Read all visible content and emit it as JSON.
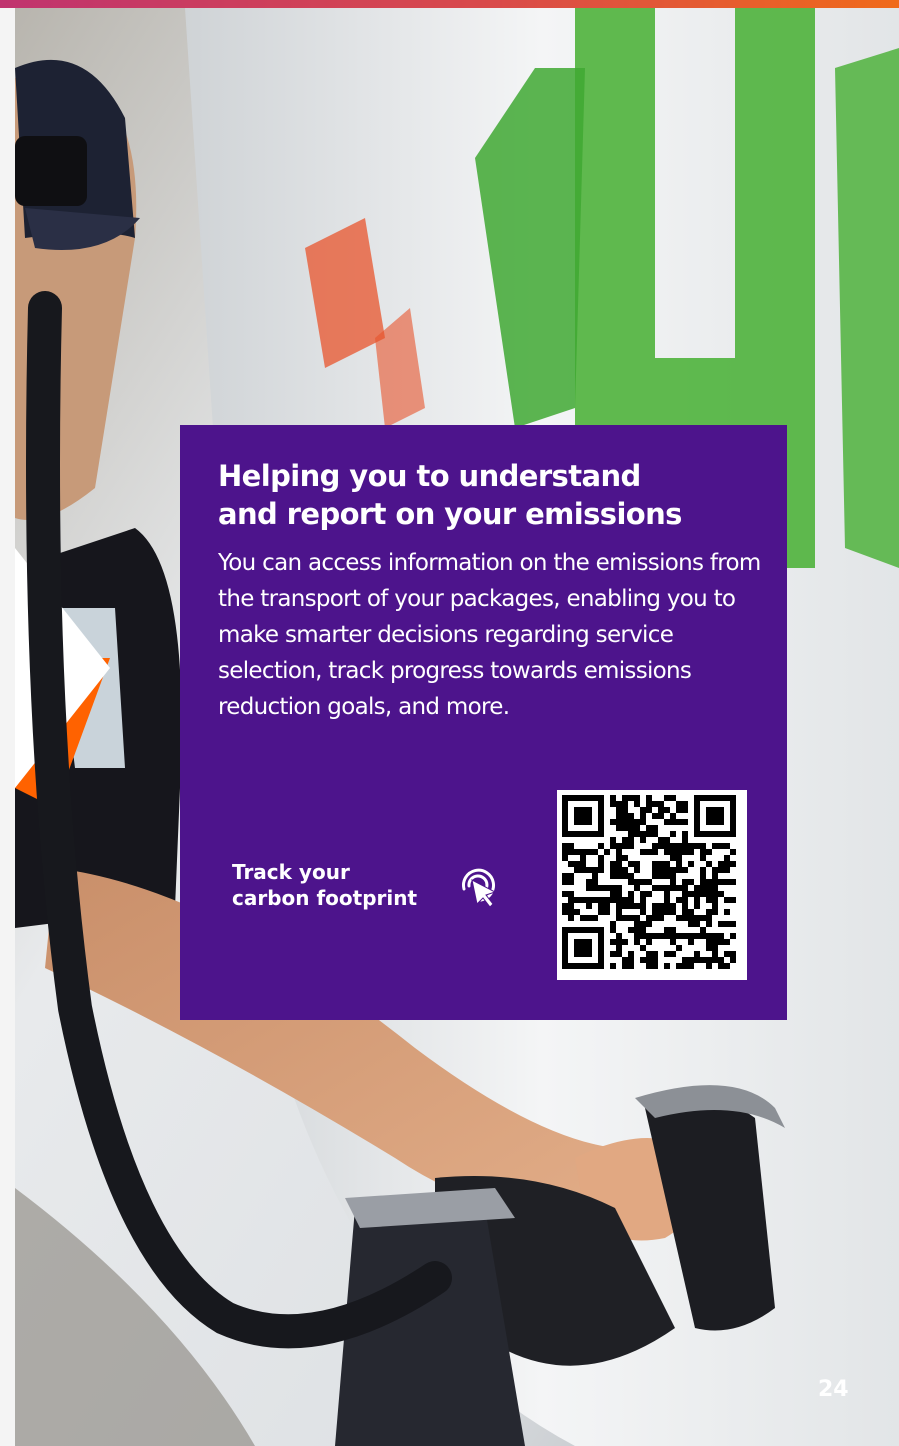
{
  "brand": {
    "purple": "#4d148c",
    "orange": "#ff6200"
  },
  "card": {
    "headline_line1": "Helping you to understand",
    "headline_line2": "and report on your emissions",
    "body": "You can access information on the emissions from the transport of your packages, enabling you to make smarter decisions regarding service selection, track progress towards emissions reduction goals, and more.",
    "cta_line1": "Track your",
    "cta_line2": "carbon footprint",
    "cta_icon": "cursor-click-icon"
  },
  "page_number": "24"
}
